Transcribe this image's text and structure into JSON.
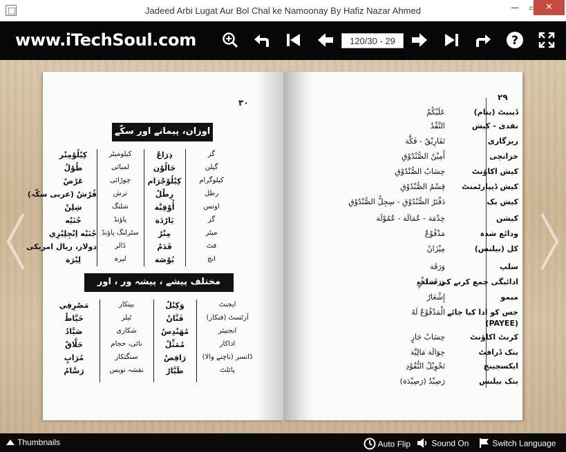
{
  "window": {
    "title": "Jadeed Arbi Lugat Aur Bol Chal ke Namoonay By Hafiz Nazar Ahmed",
    "min": "—",
    "max": "▭",
    "close": "✕"
  },
  "toolbar": {
    "brand": "www.iTechSoul.com",
    "page_value": "120/30 - 29",
    "icons": [
      "zoom-in-icon",
      "undo-icon",
      "first-page-icon",
      "previous-page-icon",
      "next-page-icon",
      "last-page-icon",
      "share-icon",
      "help-icon",
      "fullscreen-icon"
    ]
  },
  "left_page": {
    "page_number": "٣٠",
    "heading1": "اوزان، پیمانے اور سکّے",
    "heading2": "مختلف پیشے ، پیشہ ور ، اور عہدیدار",
    "table1": [
      [
        "گز",
        "ذِرَاعٌ",
        "کیلومیٹر",
        "کِیْلُوْمِتْر"
      ],
      [
        "گیلن",
        "جَالُوْن",
        "لمبائی",
        "طُوْلٌ"
      ],
      [
        "کیلوگرام",
        "کِیْلُوْجْرَام",
        "چوڑائی",
        "عَرْضٌ"
      ],
      [
        "رطل",
        "رِطْلٌ",
        "ترش",
        "قُرْشٌ (عربی سکّہ)"
      ],
      [
        "اونس",
        "أُوْقِيَّة",
        "شلنگ",
        "شِلِنْ"
      ],
      [
        "گز",
        "یَارْدَة",
        "پاؤنڈ",
        "جُنَيْه"
      ],
      [
        "میٹر",
        "مِتْرٌ",
        "سٹرلنگ پاؤنڈ",
        "جُنَيْه اِنْجِلِيْزِي"
      ],
      [
        "فٹ",
        "قَدَمٌ",
        "ڈالر",
        "دولار، ریال امریکی"
      ],
      [
        "انچ",
        "بُوْصَة",
        "لیرہ",
        "لِيْرَة"
      ]
    ],
    "table2": [
      [
        "ایجنٹ",
        "وَكِيْلٌ",
        "بینکار",
        "مَصْرِفِي"
      ],
      [
        "آرٹسٹ (فنکار)",
        "فَنَّانٌ",
        "ٹیلر",
        "خَيَّاطٌ"
      ],
      [
        "انجنیئر",
        "مُهَنْدِسٌ",
        "شکاری",
        "صَيَّادٌ"
      ],
      [
        "اداکار",
        "مُمَثِّلٌ",
        "نائی، حجام",
        "حَلَّاقٌ"
      ],
      [
        "ڈانسر (ناچنے والا)",
        "رَاقِصٌ",
        "سنگتکار",
        "مُرَابٍ"
      ],
      [
        "پائلٹ",
        "طَيَّارٌ",
        "نقشہ نویس",
        "رَسَّامٌ"
      ]
    ]
  },
  "right_page": {
    "page_number": "٢٩",
    "entries": [
      [
        "ڈیبیٹ (بنام)",
        "عَلَيْكُمْ"
      ],
      [
        "نقدی - کیش",
        "النَّقْدُ"
      ],
      [
        "ریزگاری",
        "تَفَارِيْقُ - فَكَّة"
      ],
      [
        "خزانچی",
        "أَمِيْنُ الصُّنْدُوْقِ"
      ],
      [
        "کیش اکاؤنٹ",
        "حِسَابُ الصُّنْدُوْقِ"
      ],
      [
        "کیش ڈیپارٹمنٹ",
        "قِسْمُ الصُّنْدُوْقِ"
      ],
      [
        "کیش بک",
        "دَفْتَرُ الصُّنْدُوْقِ - سِجِلُّ الصُّنْدُوْقِ"
      ],
      [
        "کیشن",
        "خِدْمَة - عُمَالَة - عُمُوْلَة"
      ],
      [
        "ودائع شدہ",
        "مَدْفُوْعٌ"
      ],
      [
        "کل (بیلنس)",
        "مِيْزَانٌ"
      ],
      [
        "سلپ",
        "وَرَقَة"
      ],
      [
        "ادائیگی جمع کرنے کی سلپ",
        "وَرَقَة دَفْعٍ"
      ],
      [
        "میمو",
        "إِشْعَارٌ"
      ],
      [
        "جس کو ادا کیا جائے",
        "الْمَدْفُوْعُ لَهُ"
      ],
      [
        "(PAYEE)",
        ""
      ],
      [
        "کرنٹ اکاؤنٹ",
        "حِسَابٌ جَارٍ"
      ],
      [
        "بنک ڈرافٹ",
        "حِوَالَة مَالِيَّة"
      ],
      [
        "ایکسچینج",
        "تَحْوِيْلُ النُّقُوْدِ"
      ],
      [
        "بنک بیلنس",
        "رَصِيْدٌ (رَصِيْدَة)"
      ]
    ]
  },
  "statusbar": {
    "thumbnails": "Thumbnails",
    "auto_flip": "Auto Flip",
    "sound": "Sound On",
    "language": "Switch Language"
  }
}
